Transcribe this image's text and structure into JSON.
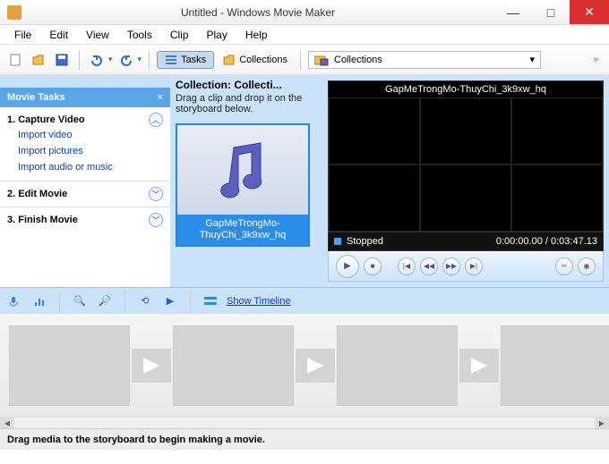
{
  "window": {
    "title": "Untitled - Windows Movie Maker"
  },
  "menu": {
    "file": "File",
    "edit": "Edit",
    "view": "View",
    "tools": "Tools",
    "clip": "Clip",
    "play": "Play",
    "help": "Help"
  },
  "toolbar": {
    "tasks_label": "Tasks",
    "collections_label": "Collections",
    "collection_select": "Collections"
  },
  "tasks_pane": {
    "header": "Movie Tasks",
    "section1": {
      "title": "1. Capture Video",
      "links": [
        "Import video",
        "Import pictures",
        "Import audio or music"
      ]
    },
    "section2": {
      "title": "2. Edit Movie"
    },
    "section3": {
      "title": "3. Finish Movie"
    }
  },
  "collection": {
    "title": "Collection: Collecti...",
    "hint": "Drag a clip and drop it on the storyboard below.",
    "clip_name": "GapMeTrongMo-ThuyChi_3k9xw_hq"
  },
  "preview": {
    "clip_title": "GapMeTrongMo-ThuyChi_3k9xw_hq",
    "status": "Stopped",
    "time": "0:00:00.00 / 0:03:47.13"
  },
  "timeline": {
    "show_link": "Show Timeline"
  },
  "statusbar": {
    "hint": "Drag media to the storyboard to begin making a movie."
  }
}
